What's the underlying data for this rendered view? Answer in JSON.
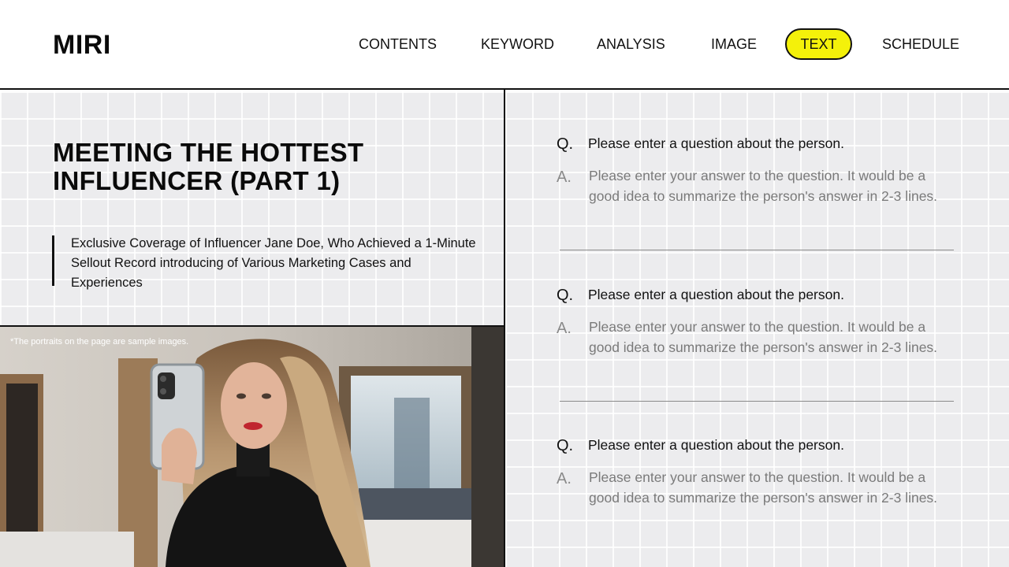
{
  "app": {
    "logo": "MIRI"
  },
  "nav": {
    "items": [
      {
        "label": "CONTENTS",
        "active": false
      },
      {
        "label": "KEYWORD",
        "active": false
      },
      {
        "label": "ANALYSIS",
        "active": false
      },
      {
        "label": "IMAGE",
        "active": false
      },
      {
        "label": "TEXT",
        "active": true
      },
      {
        "label": "SCHEDULE",
        "active": false
      }
    ]
  },
  "article": {
    "title_line1": "MEETING THE HOTTEST",
    "title_line2": "INFLUENCER (PART 1)",
    "subtitle": "Exclusive Coverage of Influencer Jane Doe, Who Achieved a 1-Minute Sellout Record introducing of Various Marketing Cases and Experiences",
    "photo_note": "*The portraits on the page are sample images."
  },
  "qa": {
    "q_marker": "Q.",
    "a_marker": "A.",
    "items": [
      {
        "question": "Please enter a question about the person.",
        "answer": "Please enter your answer to the question. It would be a good idea to summarize the person's answer in 2-3 lines."
      },
      {
        "question": "Please enter a question about the person.",
        "answer": "Please enter your answer to the question. It would be a good idea to summarize the person's answer in 2-3 lines."
      },
      {
        "question": "Please enter a question about the person.",
        "answer": "Please enter your answer to the question. It would be a good idea to summarize the person's answer in 2-3 lines."
      }
    ]
  },
  "colors": {
    "accent": "#f4f10a",
    "ink": "#111111",
    "grid_bg": "#ececee",
    "muted_text": "#7a7a7a"
  }
}
